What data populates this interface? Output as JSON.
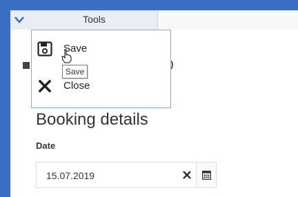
{
  "header": {
    "tools_tab": "Tools"
  },
  "tools_menu": {
    "items": [
      {
        "label": "Save",
        "icon": "save-icon"
      },
      {
        "label": "Close",
        "icon": "close-icon"
      }
    ],
    "tooltip": "Save"
  },
  "booking": {
    "heading": "Booking details",
    "date_label": "Date",
    "date_value": "15.07.2019"
  },
  "colors": {
    "accent": "#3b6fc4",
    "tab_bg": "#e9edf5"
  }
}
